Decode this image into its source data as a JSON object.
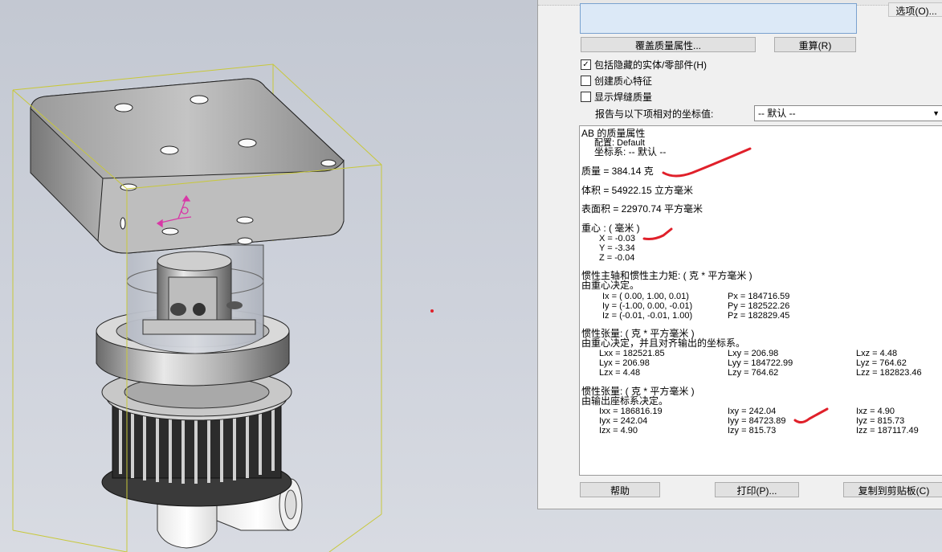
{
  "dialog": {
    "options_label": "选项(O)...",
    "override_button": "覆盖质量属性...",
    "recalc_button": "重算(R)",
    "checkboxes": [
      {
        "label": "包括隐藏的实体/零部件(H)",
        "checked": "✓"
      },
      {
        "label": "创建质心特征",
        "checked": ""
      },
      {
        "label": "显示焊缝质量",
        "checked": ""
      }
    ],
    "coord_label": "报告与以下项相对的坐标值:",
    "coord_value": "-- 默认 --",
    "help_button": "帮助",
    "print_button": "打印(P)...",
    "copy_button": "复制到剪贴板(C)"
  },
  "report": {
    "header": "AB 的质量属性",
    "config": "配置:   Default",
    "coordsys": "坐标系:  -- 默认 --",
    "mass": "质量 = 384.14 克",
    "volume": "体积 = 54922.15 立方毫米",
    "area": "表面积 = 22970.74  平方毫米",
    "com_title": "重心 : ( 毫米 )",
    "com": [
      "X = -0.03",
      "Y = -3.34",
      "Z = -0.04"
    ],
    "principal_title": "惯性主轴和惯性主力矩: ( 克 *  平方毫米 )",
    "principal_sub": "由重心决定。",
    "principal_axes": [
      "Ix = ( 0.00,  1.00,  0.01)",
      "Iy = (-1.00,  0.00, -0.01)",
      "Iz = (-0.01, -0.01,  1.00)"
    ],
    "principal_moments": [
      "Px = 184716.59",
      "Py = 182522.26",
      "Pz = 182829.45"
    ],
    "tensor_com_title": "惯性张量: ( 克 *  平方毫米 )",
    "tensor_com_sub": "由重心决定，并且对齐输出的坐标系。",
    "tensor_com": [
      [
        "Lxx = 182521.85",
        "Lxy = 206.98",
        "Lxz = 4.48"
      ],
      [
        "Lyx = 206.98",
        "Lyy = 184722.99",
        "Lyz = 764.62"
      ],
      [
        "Lzx = 4.48",
        "Lzy = 764.62",
        "Lzz = 182823.46"
      ]
    ],
    "tensor_out_title": "惯性张量: ( 克 *  平方毫米 )",
    "tensor_out_sub": "由输出座标系决定。",
    "tensor_out": [
      [
        "Ixx = 186816.19",
        "Ixy = 242.04",
        "Ixz = 4.90"
      ],
      [
        "Iyx = 242.04",
        "Iyy = 84723.89",
        "Iyz = 815.73"
      ],
      [
        "Izx = 4.90",
        "Izy = 815.73",
        "Izz = 187117.49"
      ]
    ]
  },
  "colors": {
    "ink": "#e0202a",
    "bbox": "#c8c83a",
    "selection": "#dce9f7"
  }
}
